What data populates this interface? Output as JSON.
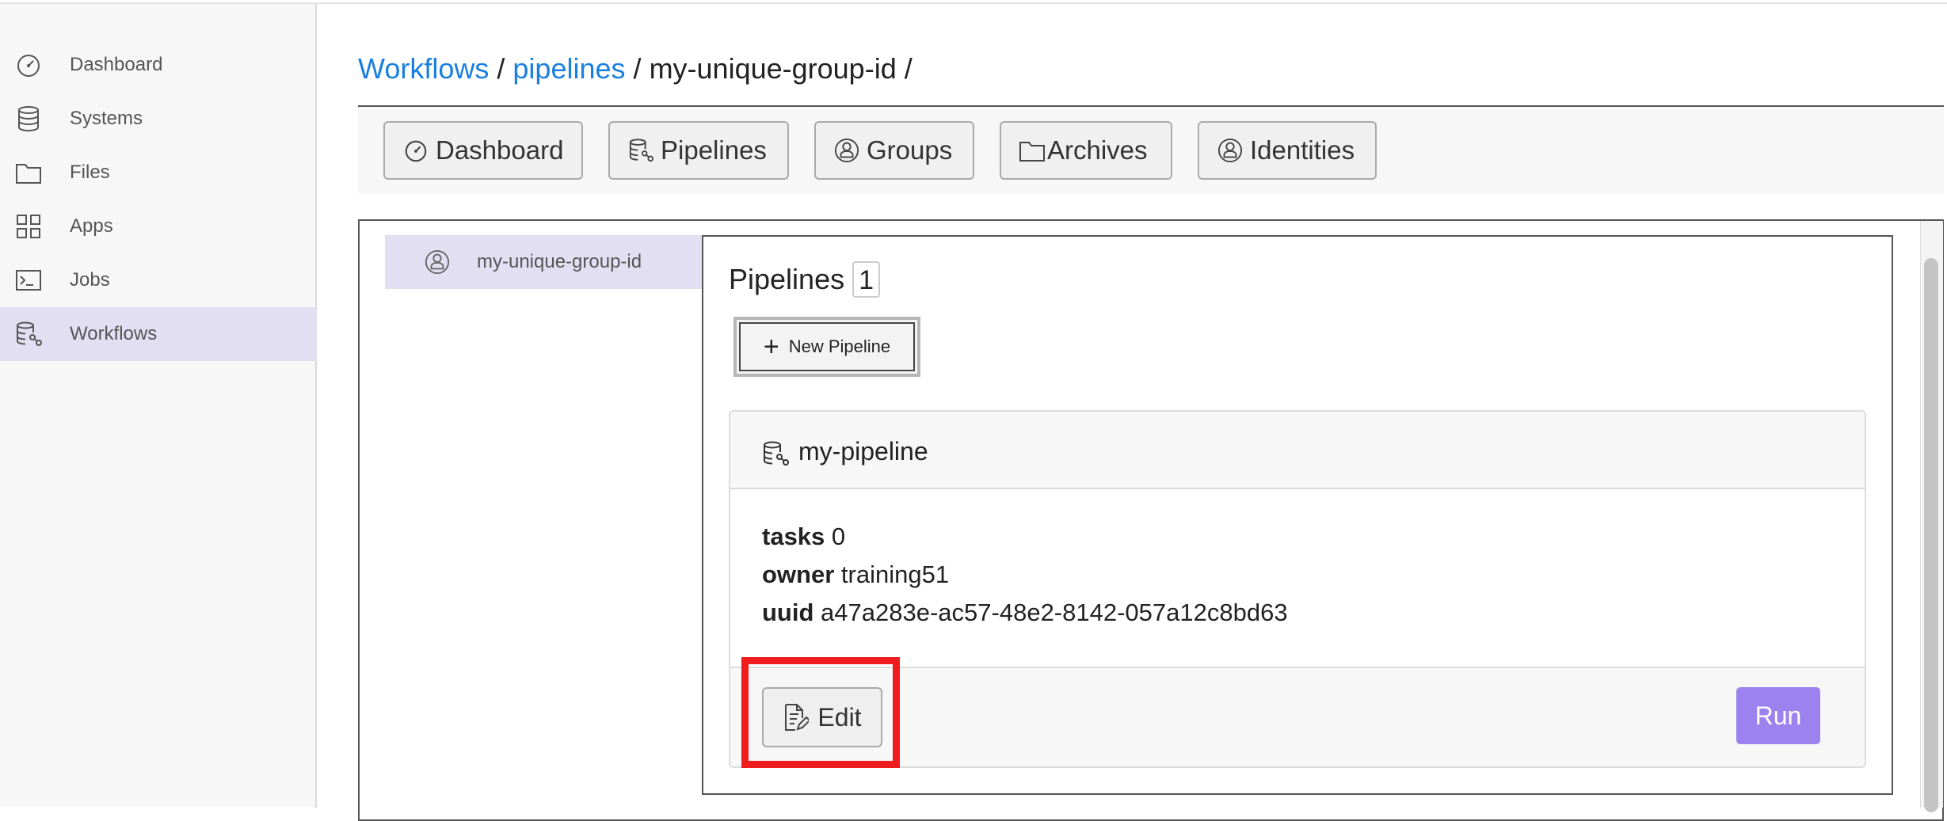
{
  "sidebar": {
    "items": [
      {
        "label": "Dashboard",
        "icon": "gauge-icon",
        "active": false
      },
      {
        "label": "Systems",
        "icon": "database-icon",
        "active": false
      },
      {
        "label": "Files",
        "icon": "folder-icon",
        "active": false
      },
      {
        "label": "Apps",
        "icon": "grid-icon",
        "active": false
      },
      {
        "label": "Jobs",
        "icon": "terminal-icon",
        "active": false
      },
      {
        "label": "Workflows",
        "icon": "pipeline-icon",
        "active": true
      }
    ]
  },
  "breadcrumb": {
    "workflows": "Workflows",
    "pipelines": "pipelines",
    "group": "my-unique-group-id",
    "sep": "/"
  },
  "toolbar": {
    "dashboard": "Dashboard",
    "pipelines": "Pipelines",
    "groups": "Groups",
    "archives": "Archives",
    "identities": "Identities"
  },
  "groups": {
    "selected": "my-unique-group-id"
  },
  "pipelines_panel": {
    "title": "Pipelines",
    "count": "1",
    "new_button": "New Pipeline",
    "plus": "+"
  },
  "pipeline": {
    "name": "my-pipeline",
    "tasks_label": "tasks",
    "tasks_value": "0",
    "owner_label": "owner",
    "owner_value": "training51",
    "uuid_label": "uuid",
    "uuid_value": "a47a283e-ac57-48e2-8142-057a12c8bd63",
    "edit_label": "Edit",
    "run_label": "Run"
  },
  "colors": {
    "link": "#1a7fe0",
    "active_bg": "#e3dff2",
    "run_button": "#9b82ef",
    "highlight": "#ee1c1c"
  }
}
